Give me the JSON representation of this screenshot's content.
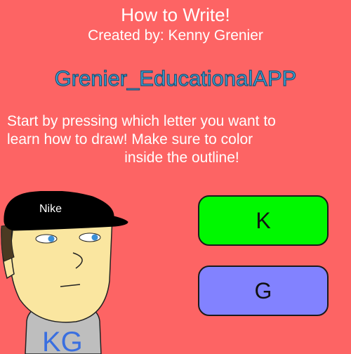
{
  "header": {
    "title": "How to Write!",
    "credit": "Created by: Kenny Grenier",
    "brand": "Grenier_EducationalAPP"
  },
  "instructions": {
    "line1": "Start by pressing which letter you want to",
    "line2": "learn how to draw! Make sure to color",
    "line3": "inside the outline!"
  },
  "buttons": {
    "k_label": "K",
    "g_label": "G"
  },
  "avatar": {
    "cap_text": "Nike",
    "shirt_text": "KG"
  },
  "colors": {
    "background": "#fd6464",
    "brand_text": "#3fa6d8",
    "k_button": "#00f800",
    "g_button": "#8282ff",
    "skin": "#fae6a0",
    "cap": "#000000",
    "shirt": "#bebebe"
  }
}
